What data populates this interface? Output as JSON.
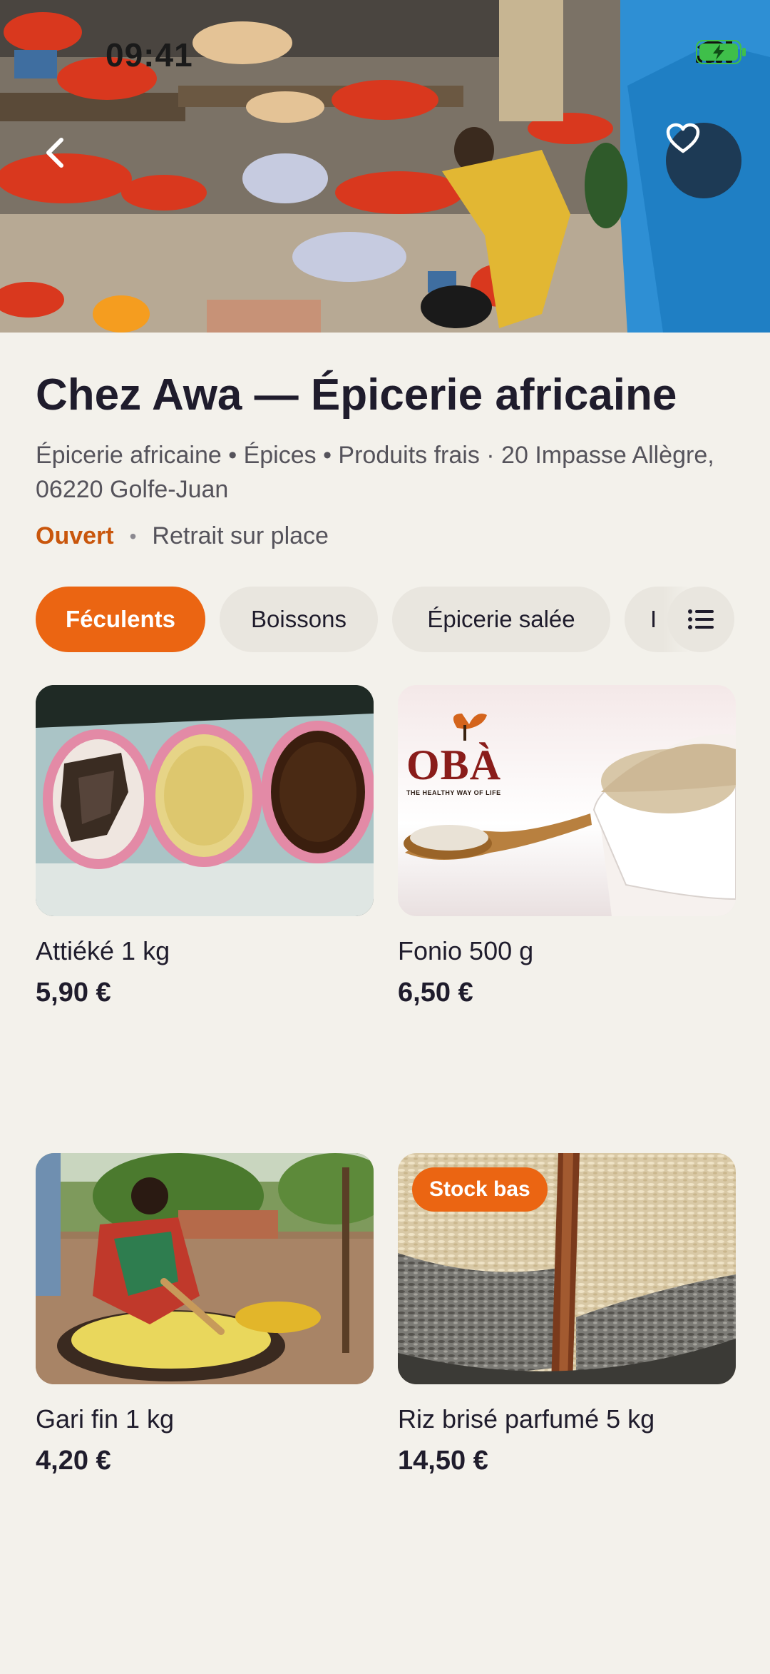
{
  "status_bar": {
    "time": "09:41"
  },
  "hero": {
    "back_icon": "chevron-left-icon",
    "favorite_icon": "heart-icon"
  },
  "store": {
    "title": "Chez Awa — Épicerie africaine",
    "address": "Épicerie africaine • Épices • Produits frais · 20 Impasse Allègre, 06220 Golfe-Juan",
    "status": "Ouvert",
    "pickup": "Retrait sur place"
  },
  "categories": [
    {
      "label": "Féculents",
      "active": true
    },
    {
      "label": "Boissons",
      "active": false
    },
    {
      "label": "Épicerie salée",
      "active": false
    },
    {
      "label": "I",
      "active": false
    }
  ],
  "filter_icon": "list-icon",
  "products": [
    {
      "name": "Attiéké 1 kg",
      "price": "5,90 €"
    },
    {
      "name": "Fonio 500 g",
      "price": "6,50 €",
      "brand_logo": "OBÀ",
      "brand_tagline": "THE HEALTHY WAY OF LIFE"
    },
    {
      "name": "Gari fin 1 kg",
      "price": "4,20 €"
    },
    {
      "name": "Riz brisé parfumé 5 kg",
      "price": "14,50 €",
      "badge": "Stock bas"
    }
  ],
  "colors": {
    "accent": "#eb6512",
    "status_open": "#c9560c",
    "favorite_bg": "#1d3a55",
    "background": "#f3f1eb"
  }
}
